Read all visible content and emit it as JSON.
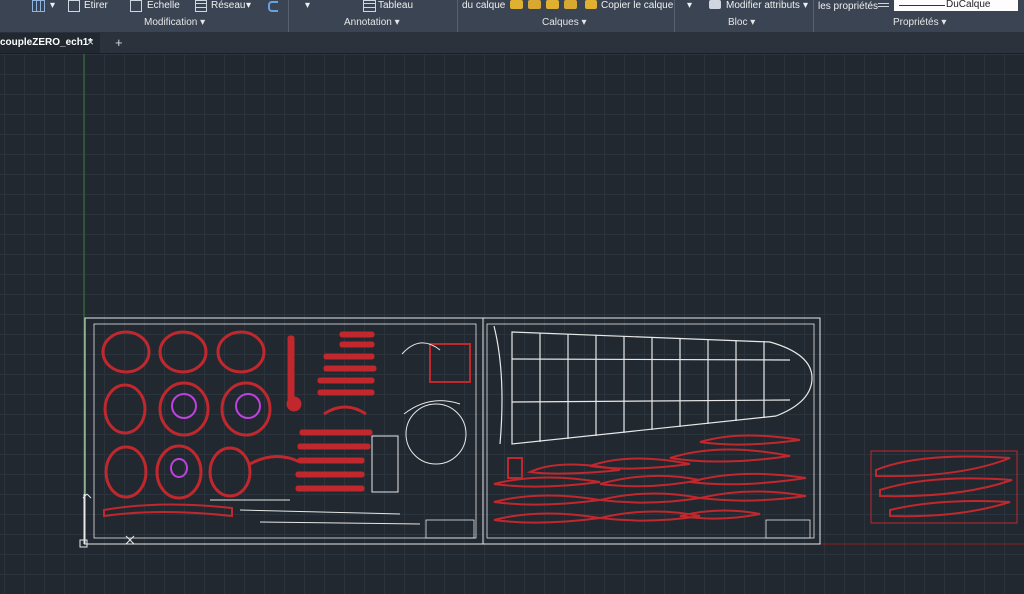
{
  "ribbon": {
    "modification": {
      "title": "Modification",
      "etirer": "Etirer",
      "echelle": "Echelle",
      "reseau": "Réseau"
    },
    "annotation": {
      "title": "Annotation",
      "tableau": "Tableau"
    },
    "calques": {
      "title": "Calques",
      "du_calque": "du calque",
      "copier": "Copier le calque"
    },
    "bloc": {
      "title": "Bloc",
      "modifier_attributs": "Modifier attributs"
    },
    "proprietes": {
      "title": "Propriétés",
      "les_proprietes": "les propriétés",
      "ducalque": "DuCalque"
    }
  },
  "tabs": {
    "active": "coupleZERO_ech1*",
    "close": "×",
    "new": "+"
  },
  "colors": {
    "ribbon": "#3b4453",
    "canvas": "#212830",
    "grid": "#2b333d",
    "part_red": "#c0282d",
    "magenta": "#c040e0",
    "white_lines": "#e8e8e8",
    "axis_green": "#3a7a3a",
    "axis_red": "#8a2020"
  }
}
